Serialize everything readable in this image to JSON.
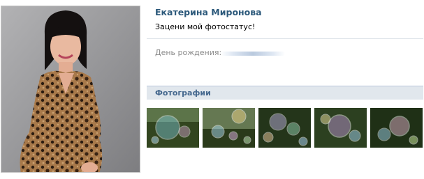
{
  "profile": {
    "name": "Екатерина Миронова",
    "status": "Зацени мой фотостатус!",
    "birthday_label": "День рождения:"
  },
  "photos": {
    "header": "Фотографии",
    "items": [
      {
        "name": "photo-thumbnail-1",
        "icon": "soap-bubbles"
      },
      {
        "name": "photo-thumbnail-2",
        "icon": "soap-bubbles"
      },
      {
        "name": "photo-thumbnail-3",
        "icon": "soap-bubbles"
      },
      {
        "name": "photo-thumbnail-4",
        "icon": "soap-bubbles"
      },
      {
        "name": "photo-thumbnail-5",
        "icon": "soap-bubbles"
      }
    ]
  },
  "colors": {
    "name_link": "#2b587a",
    "section_header_bg": "#e1e7ed",
    "section_header_text": "#45688e",
    "label_gray": "#8a8a8a"
  }
}
